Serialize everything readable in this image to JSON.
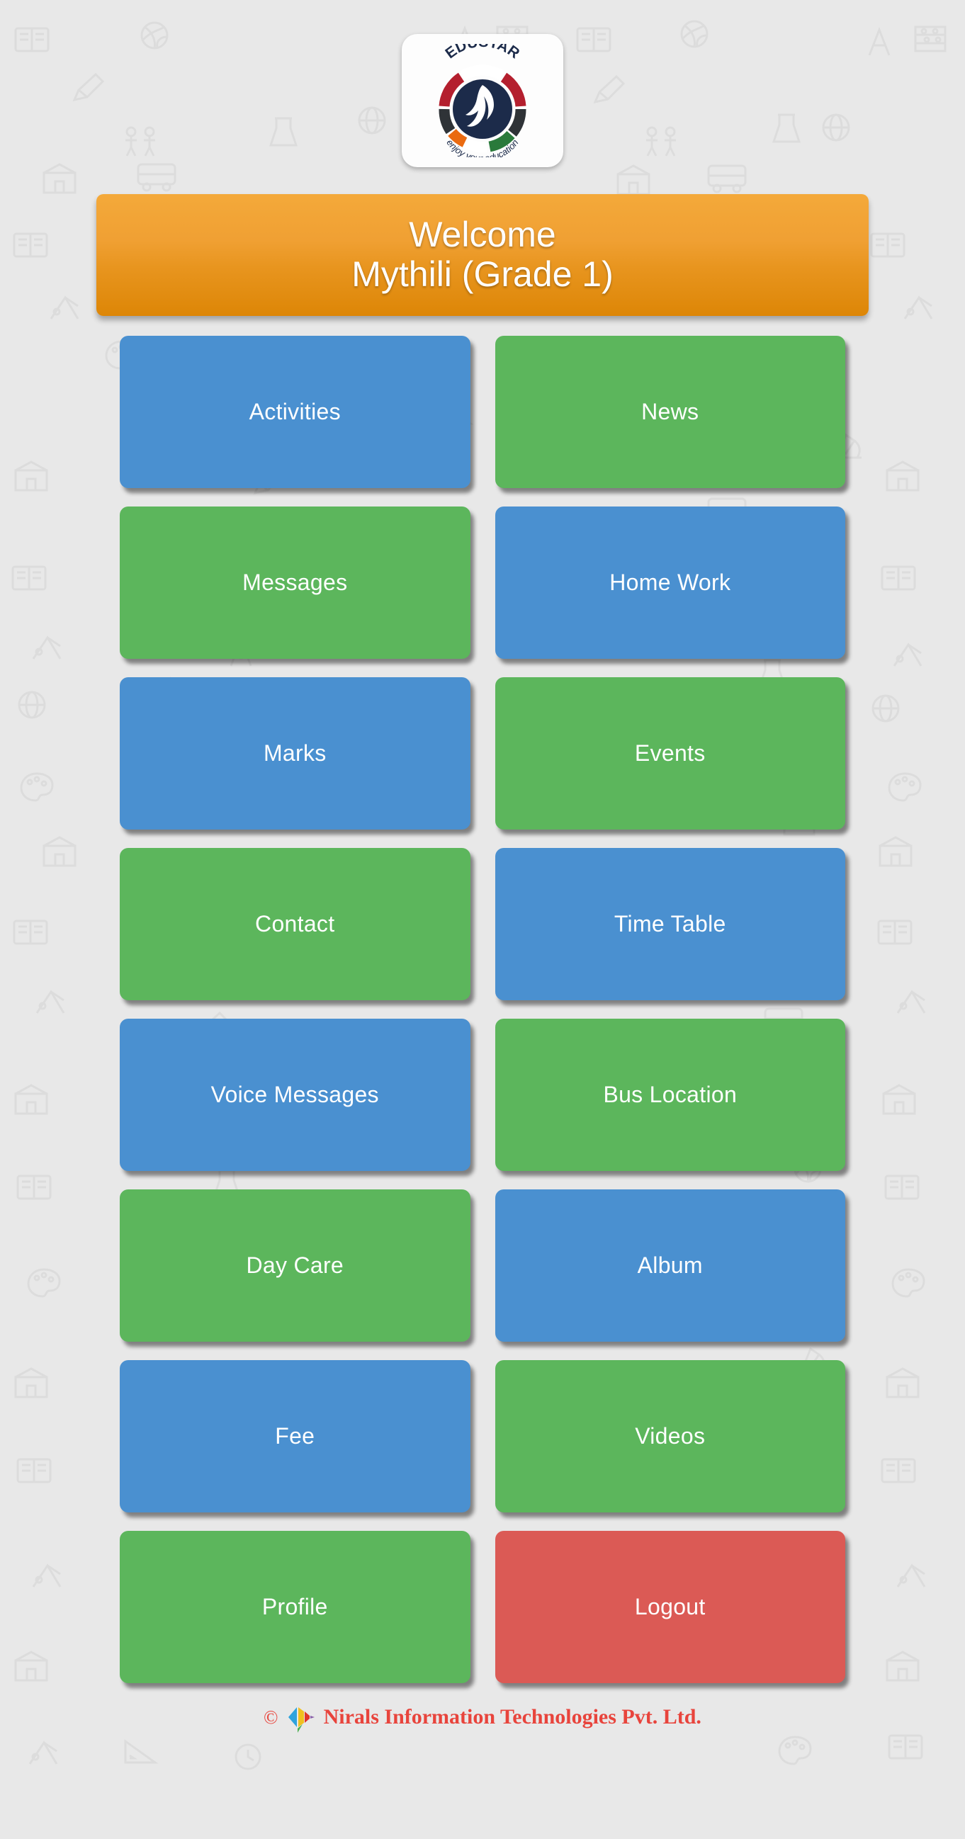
{
  "app": {
    "logo": {
      "brand_top": "EDUSTAR",
      "tagline": "enjoy your education",
      "icon": "edustar-dove-logo"
    }
  },
  "welcome": {
    "greeting": "Welcome",
    "student": "Mythili (Grade 1)"
  },
  "colors": {
    "blue": "#4a90d0",
    "green": "#5cb65c",
    "red": "#db5a55",
    "banner_orange": "#e8951f",
    "footer_red": "#e8443c",
    "background": "#e8e8e8"
  },
  "menu": {
    "tiles": [
      {
        "label": "Activities",
        "color": "blue",
        "name": "tile-activities"
      },
      {
        "label": "News",
        "color": "green",
        "name": "tile-news"
      },
      {
        "label": "Messages",
        "color": "green",
        "name": "tile-messages"
      },
      {
        "label": "Home Work",
        "color": "blue",
        "name": "tile-home-work"
      },
      {
        "label": "Marks",
        "color": "blue",
        "name": "tile-marks"
      },
      {
        "label": "Events",
        "color": "green",
        "name": "tile-events"
      },
      {
        "label": "Contact",
        "color": "green",
        "name": "tile-contact"
      },
      {
        "label": "Time Table",
        "color": "blue",
        "name": "tile-time-table"
      },
      {
        "label": "Voice Messages",
        "color": "blue",
        "name": "tile-voice-messages"
      },
      {
        "label": "Bus Location",
        "color": "green",
        "name": "tile-bus-location"
      },
      {
        "label": "Day Care",
        "color": "green",
        "name": "tile-day-care"
      },
      {
        "label": "Album",
        "color": "blue",
        "name": "tile-album"
      },
      {
        "label": "Fee",
        "color": "blue",
        "name": "tile-fee"
      },
      {
        "label": "Videos",
        "color": "green",
        "name": "tile-videos"
      },
      {
        "label": "Profile",
        "color": "green",
        "name": "tile-profile"
      },
      {
        "label": "Logout",
        "color": "red",
        "name": "tile-logout"
      }
    ]
  },
  "footer": {
    "copyright_symbol": "©",
    "company": "Nirals Information Technologies Pvt. Ltd.",
    "icon": "nirals-logo"
  }
}
